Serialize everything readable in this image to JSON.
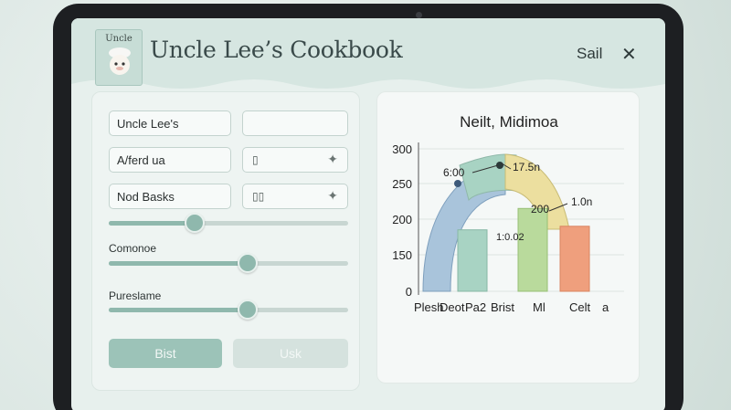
{
  "app": {
    "title": "Uncle Lee’s Cookbook",
    "logo_text": "Uncle",
    "header_action": "Sail",
    "close_glyph": "✕"
  },
  "form": {
    "name_value": "Uncle Lee's",
    "name2_value": "",
    "field2_value": "A/ferd ua",
    "field2_side_icon": "▯",
    "field3_value": "Nod Basks",
    "field3_side_icon": "▯▯",
    "star_glyph": "✦",
    "slider1": {
      "label": "",
      "fraction": 0.36
    },
    "slider2": {
      "label": "Comonoe",
      "fraction": 0.58
    },
    "slider3": {
      "label": "Pureslame",
      "fraction": 0.58
    },
    "primary_button": "Bist",
    "secondary_button": "Usk"
  },
  "icons": {
    "logo": "chef-face-icon",
    "close": "close-icon",
    "star": "sparkle-icon",
    "field_side": "document-icon"
  },
  "colors": {
    "accent": "#8fb8ad",
    "bar_blue": "#a9c4db",
    "bar_teal": "#a8d3c3",
    "bar_green": "#b9da9c",
    "bar_orange": "#ef9f7d",
    "arc_yellow": "#ecdf9f"
  },
  "chart_data": {
    "type": "bar",
    "title": "Neilt, Midimoa",
    "categories": [
      "Plesh",
      "Deot",
      "Pa2",
      "Brist",
      "Ml",
      "Celt"
    ],
    "x_extra_label": "a",
    "series": [
      {
        "values": [
          null,
          null,
          185,
          null,
          215,
          190
        ]
      }
    ],
    "arch": {
      "segments": [
        {
          "from": "Plesh",
          "to": "Pa2",
          "peak": 235
        },
        {
          "from": "Pa2",
          "to": "Brist",
          "peak": 275
        },
        {
          "from": "Brist",
          "to": "Ml",
          "peak": 280
        }
      ]
    },
    "yticks": [
      0,
      150,
      200,
      250,
      300
    ],
    "ylim": [
      0,
      300
    ],
    "annotations": [
      "6:00",
      "17.5n",
      "200",
      "1.0n",
      "1:0.02"
    ],
    "grid": true
  }
}
